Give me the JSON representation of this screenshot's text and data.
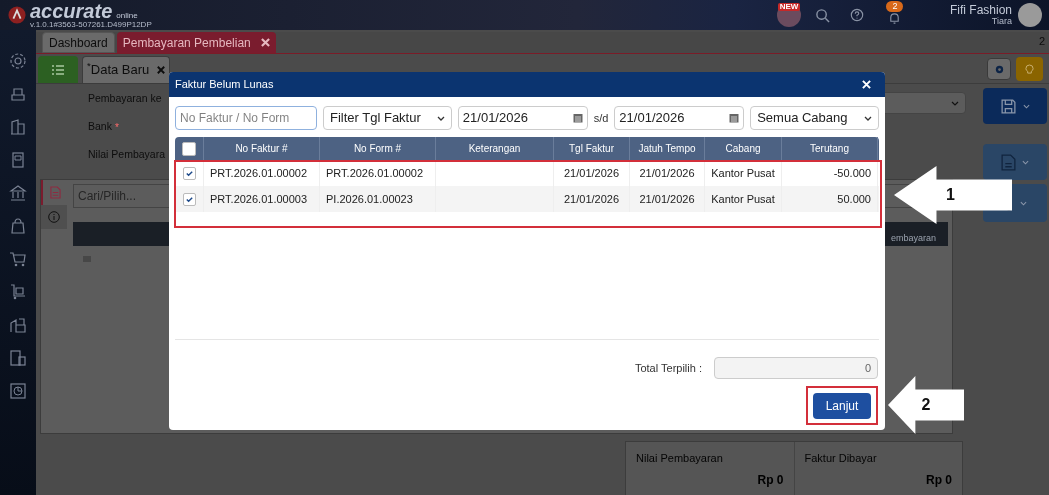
{
  "header": {
    "logo": "accurate",
    "logo_sub": "online",
    "version": "v.1.0.1#3563-507261.D499P12DP",
    "new_badge": "NEW",
    "notification_count": "2",
    "company": "Fifi Fashion",
    "user": "Tiara"
  },
  "tabs": [
    {
      "label": "Dashboard",
      "selected": false
    },
    {
      "label": "Pembayaran Pembelian",
      "selected": true
    }
  ],
  "window_count": "2",
  "subtab": {
    "label": "Data Baru",
    "modified_mark": "*"
  },
  "form_fields": [
    {
      "label": "Pembayaran ke"
    },
    {
      "label": "Bank",
      "required_mark": "*"
    },
    {
      "label": "Nilai Pembayara"
    }
  ],
  "detail": {
    "search_placeholder": "Cari/Pilih...",
    "column_header": "embayaran"
  },
  "summary": [
    {
      "label": "Nilai Pembayaran",
      "value": "Rp 0"
    },
    {
      "label": "Faktur Dibayar",
      "value": "Rp 0"
    }
  ],
  "dialog": {
    "title": "Faktur Belum Lunas",
    "search_placeholder": "No Faktur / No Form",
    "date_filter": "Filter Tgl Faktur",
    "date_from": "21/01/2026",
    "range_label": "s/d",
    "date_to": "21/01/2026",
    "branch": "Semua Cabang",
    "select_all": false,
    "columns": [
      "No Faktur #",
      "No Form #",
      "Keterangan",
      "Tgl Faktur",
      "Jatuh Tempo",
      "Cabang",
      "Terutang"
    ],
    "rows": [
      {
        "checked": true,
        "cells": [
          "PRT.2026.01.00002",
          "PRT.2026.01.00002",
          "",
          "21/01/2026",
          "21/01/2026",
          "Kantor Pusat",
          "-50.000"
        ]
      },
      {
        "checked": true,
        "cells": [
          "PRT.2026.01.00003",
          "PI.2026.01.00023",
          "",
          "21/01/2026",
          "21/01/2026",
          "Kantor Pusat",
          "50.000"
        ]
      }
    ],
    "total_label": "Total Terpilih :",
    "total_value": "0",
    "button": "Lanjut"
  },
  "annotations": [
    {
      "label": "1"
    },
    {
      "label": "2"
    }
  ]
}
